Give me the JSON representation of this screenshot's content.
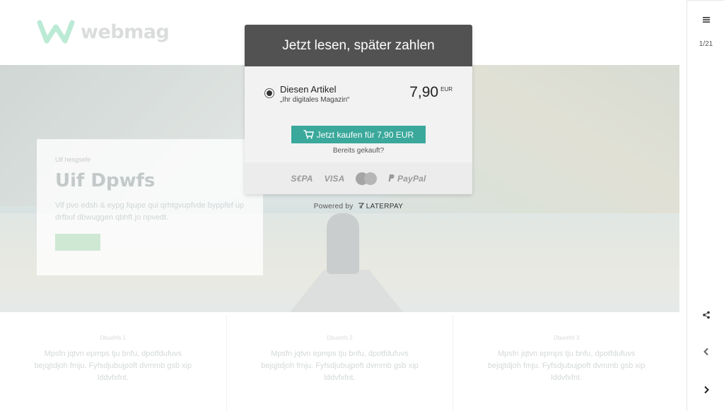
{
  "background": {
    "logo_text": "webmag",
    "hero": {
      "kicker": "Uif hesgsefe",
      "title": "Uif Dpwfs",
      "text": "Vif pvo edsh & eypg fqupe qui qrhtgvupfvde byppfef up drfbuf dbwuggen qbhft jo npvedt.",
      "button_label": "Xbhfosf"
    },
    "columns": [
      {
        "kicker": "Dbuohfs 1",
        "text": "Mpsfn jqtvn epmps tju bnfu, dpotfdufuvs bejqjtdjoh fmju. Fyfsdjubujpoft dvmmb gsb xip lddvfxfnt."
      },
      {
        "kicker": "Dbuohfs 2",
        "text": "Mpsfn jqtvn epmps tju bnfu, dpotfdufuvs bejqjtdjoh fmju. Fyfsdjubujpoft dvmmb gsb xip lddvfxfnt."
      },
      {
        "kicker": "Dbuohfs 3",
        "text": "Mpsfn jqtvn epmps tju bnfu, dpotfdufuvs bejqjtdjoh fmju. Fyfsdjubujpoft dvmmb gsb xip lddvfxfnt."
      }
    ]
  },
  "sidebar": {
    "page_indicator": "1/21",
    "icons": [
      "menu-icon",
      "share-icon",
      "chevron-left-icon",
      "chevron-right-icon"
    ]
  },
  "paywall": {
    "title": "Jetzt lesen, später zahlen",
    "option": {
      "label": "Diesen Artikel",
      "sublabel": "„Ihr digitales Magazin“",
      "price": "7,90",
      "currency": "EUR"
    },
    "buy_button_label": "Jetzt kaufen für 7,90 EUR",
    "already_bought_link": "Bereits gekauft?",
    "payment_methods": [
      "S€PA",
      "VISA",
      "PayPal"
    ],
    "powered_by_label": "Powered by",
    "powered_by_brand": "LATERPAY",
    "colors": {
      "header": "#525252",
      "button": "#3aa89b"
    }
  }
}
